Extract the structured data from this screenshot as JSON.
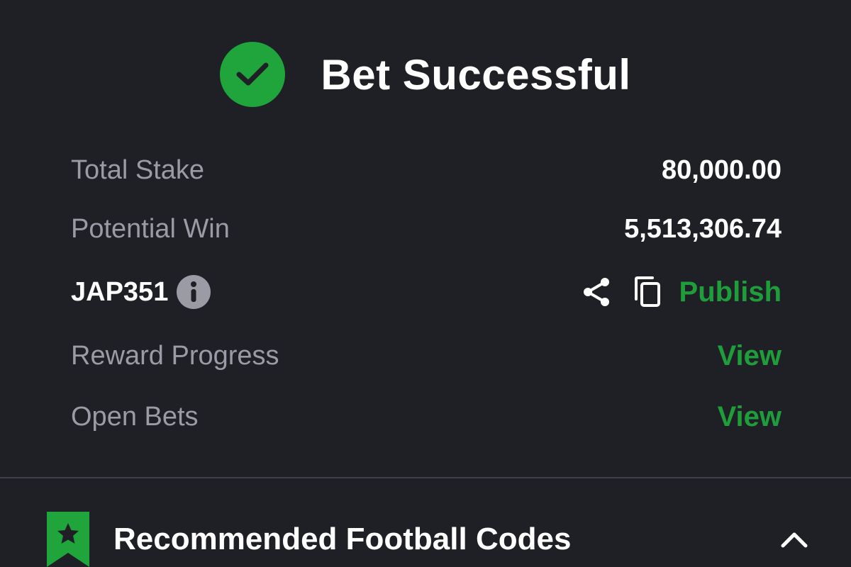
{
  "header": {
    "title": "Bet Successful",
    "success_color": "#1fa53b",
    "icon": "check-circle-icon"
  },
  "summary": {
    "total_stake_label": "Total Stake",
    "total_stake_value": "80,000.00",
    "potential_win_label": "Potential Win",
    "potential_win_value": "5,513,306.74"
  },
  "booking": {
    "code": "JAP351",
    "info_icon": "info-icon",
    "share_icon": "share-icon",
    "copy_icon": "copy-icon",
    "publish_label": "Publish"
  },
  "links": {
    "reward_progress_label": "Reward Progress",
    "reward_progress_action": "View",
    "open_bets_label": "Open Bets",
    "open_bets_action": "View",
    "accent_color": "#1f9d3b"
  },
  "recommended": {
    "title": "Recommended Football Codes",
    "icon": "star-bookmark-icon",
    "toggle_icon": "chevron-up-icon"
  }
}
